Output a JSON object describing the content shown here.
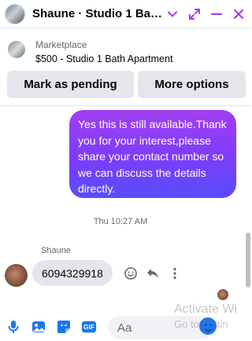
{
  "header": {
    "title": "Shaune · Studio 1 Bath...",
    "accent_color": "#a33ef0"
  },
  "listing": {
    "source": "Marketplace",
    "title": "$500 - Studio 1 Bath Apartment"
  },
  "actions": {
    "pending_label": "Mark as pending",
    "more_label": "More options"
  },
  "messages": {
    "outgoing": [
      {
        "text": "Yes this is still available.Thank you for your interest,please share your contact number so we can discuss the details directly."
      }
    ],
    "timestamp": "Thu 10:27 AM",
    "incoming": {
      "sender": "Shaune",
      "text": "6094329918"
    }
  },
  "composer": {
    "placeholder": "Aa",
    "icons": [
      "microphone-icon",
      "photo-icon",
      "sticker-icon",
      "gif-icon",
      "emoji-icon"
    ],
    "gif_label": "GIF"
  },
  "watermark": {
    "line1": "Activate Wi",
    "line2": "Go to Settin"
  },
  "colors": {
    "bubble_gradient_top": "#a33ef0",
    "bubble_gradient_bottom": "#5a4cfb",
    "icon_accent": "#a33ef0",
    "composer_icon": "#1877f2"
  }
}
